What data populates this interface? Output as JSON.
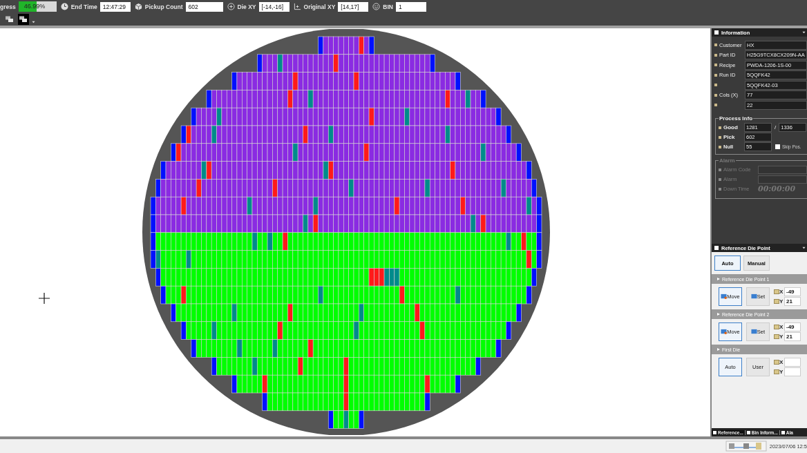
{
  "toolbar": {
    "progress": {
      "label": "gress",
      "level": 0.4699,
      "reading": "46.99%"
    },
    "fields": [
      {
        "kind": "clock",
        "label": "End Time",
        "value": "12:47:29"
      },
      {
        "kind": "box",
        "label": "Pickup Count",
        "value": "602"
      },
      {
        "kind": "target",
        "label": "Die XY",
        "value": "[-14,-16]"
      },
      {
        "kind": "axes",
        "label": "Original XY",
        "value": "[14,17]"
      },
      {
        "kind": "smiley",
        "label": "BIN",
        "value": "1"
      }
    ],
    "tools": [
      {
        "selected": false
      },
      {
        "selected": true
      }
    ]
  },
  "information": {
    "title": "Information",
    "fields": [
      {
        "label": "Customer",
        "value": "HX"
      },
      {
        "label": "Part ID",
        "value": "H25G9TCX8CX209N-AA"
      },
      {
        "label": "Recipe",
        "value": "PWDA-1206-1S-00"
      },
      {
        "label": "Run ID",
        "value": "5QQFK42"
      },
      {
        "value": "5QQFK42-03"
      },
      {
        "label": "Cols (X)",
        "value": "77"
      },
      {
        "value": "22"
      }
    ]
  },
  "process_info": {
    "title": "Process Info",
    "separator": "/",
    "rows": [
      {
        "label": "Good",
        "value": "1281",
        "extra": "1336"
      },
      {
        "label": "Pick",
        "value": "602"
      },
      {
        "label": "Null",
        "value": "55"
      }
    ],
    "skip": {
      "label": "Skip Pos.",
      "checked": false
    }
  },
  "alarm": {
    "title": "Alarm",
    "disabled": true,
    "rows": [
      {
        "kind": "field",
        "label": "Alarm Code"
      },
      {
        "kind": "field",
        "label": "Alarm"
      },
      {
        "kind": "timer",
        "label": "Down Time",
        "value": "00:00:00"
      }
    ]
  },
  "reference": {
    "title": "Reference Die Point",
    "modes": [
      {
        "label": "Auto",
        "selected": true
      },
      {
        "label": "Manual",
        "selected": false
      }
    ],
    "sections": [
      {
        "title": "Reference Die Point 1",
        "buttons": [
          {
            "kind": "move",
            "label": "Move",
            "selected": true
          },
          {
            "kind": "set",
            "label": "Set",
            "selected": false
          }
        ],
        "coords": [
          {
            "label": "X",
            "value": "-49"
          },
          {
            "label": "Y",
            "value": "21"
          }
        ]
      },
      {
        "title": "Reference Die Point 2",
        "buttons": [
          {
            "kind": "move",
            "label": "Move",
            "selected": true
          },
          {
            "kind": "set",
            "label": "Set",
            "selected": false
          }
        ],
        "coords": [
          {
            "label": "X",
            "value": "-49"
          },
          {
            "label": "Y",
            "value": "21"
          }
        ]
      },
      {
        "title": "First Die",
        "buttons": [
          {
            "kind": "plain",
            "label": "Auto",
            "selected": true
          },
          {
            "kind": "plain",
            "label": "User",
            "selected": false
          }
        ],
        "coords": [
          {
            "label": "X"
          },
          {
            "label": "Y"
          }
        ]
      }
    ]
  },
  "bottom_tabs": [
    {
      "label": "Reference...",
      "selected": true
    },
    {
      "label": "Bin Inform...",
      "selected": false
    },
    {
      "label": "Ala",
      "selected": false
    }
  ],
  "status_bar": {
    "datetime": "2023/07/06 12:5"
  }
}
